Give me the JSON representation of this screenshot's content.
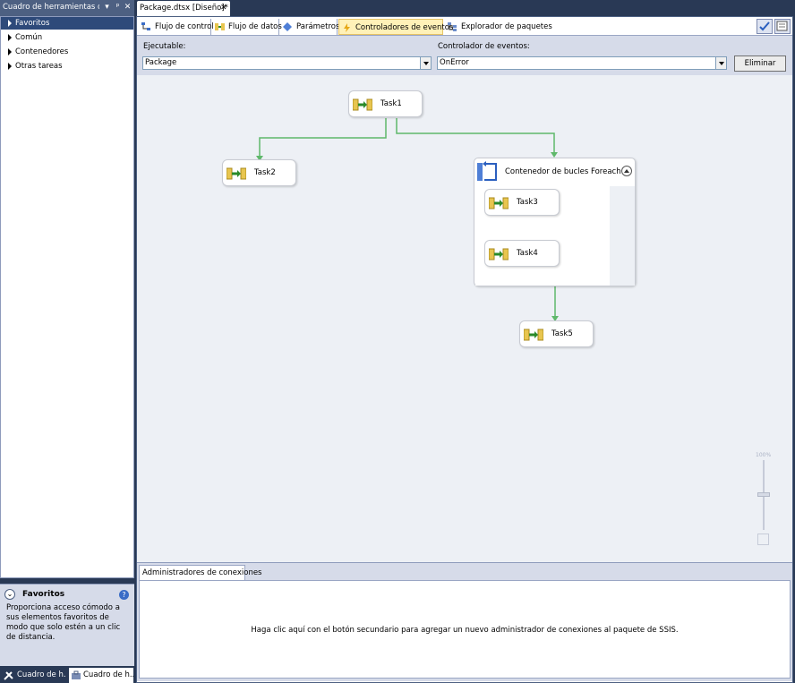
{
  "toolbox": {
    "title": "Cuadro de herramientas de...",
    "items": [
      {
        "label": "Favoritos",
        "selected": true
      },
      {
        "label": "Común"
      },
      {
        "label": "Contenedores"
      },
      {
        "label": "Otras tareas"
      }
    ],
    "desc_title": "Favoritos",
    "desc_body": "Proporciona acceso cómodo a sus elementos favoritos de modo que solo estén a un clic de distancia.",
    "bottom_tabs": [
      "Cuadro de h...",
      "Cuadro de h..."
    ]
  },
  "document": {
    "tab_title": "Package.dtsx [Diseño]*"
  },
  "designer": {
    "tabs": [
      {
        "label": "Flujo de control",
        "icon": "control-flow-icon"
      },
      {
        "label": "Flujo de datos",
        "icon": "data-flow-icon"
      },
      {
        "label": "Parámetros",
        "icon": "parameters-icon"
      },
      {
        "label": "Controladores de eventos",
        "icon": "event-handler-icon",
        "active": true
      },
      {
        "label": "Explorador de paquetes",
        "icon": "package-explorer-icon"
      }
    ],
    "executable_label": "Ejecutable:",
    "executable_value": "Package",
    "event_handler_label": "Controlador de eventos:",
    "event_handler_value": "OnError",
    "delete_button": "Eliminar"
  },
  "canvas": {
    "tasks": [
      "Task1",
      "Task2",
      "Task3",
      "Task4",
      "Task5"
    ],
    "container_label": "Contenedor de bucles Foreach",
    "zoom_label": "100%",
    "precedence_color": "#5fb86b"
  },
  "connections": {
    "tab_label": "Administradores de conexiones",
    "message": "Haga clic aquí con el botón secundario para agregar un nuevo administrador de conexiones al paquete de SSIS."
  }
}
